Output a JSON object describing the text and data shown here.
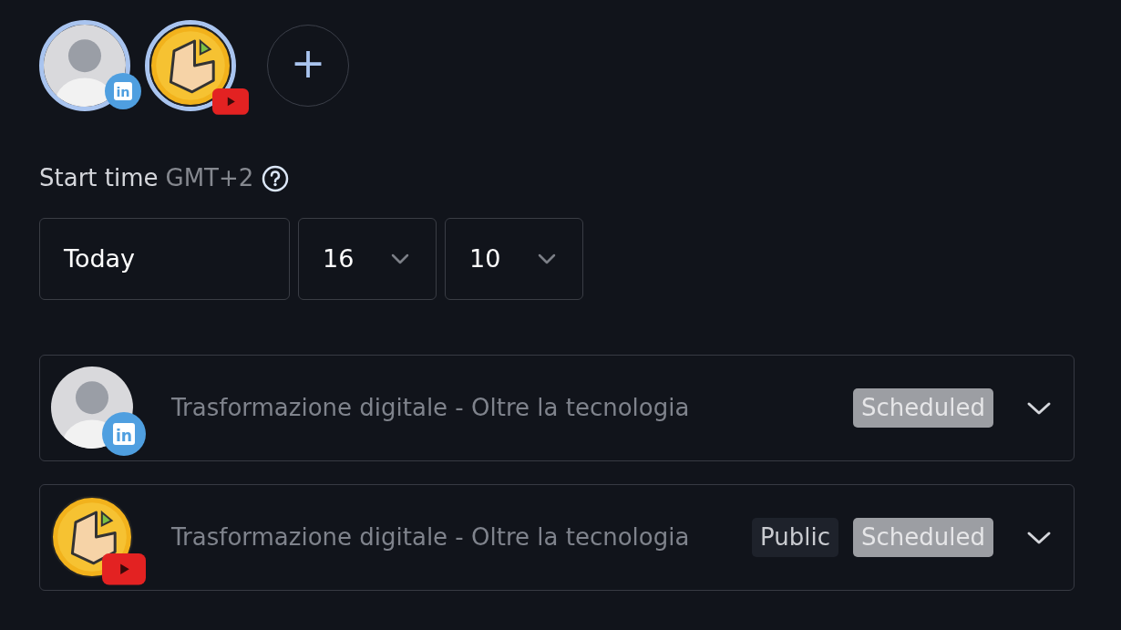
{
  "destinations": [
    {
      "kind": "linkedin",
      "icon_text": "in",
      "selected": true
    },
    {
      "kind": "youtube",
      "selected": true
    }
  ],
  "add_button": "+",
  "start_time": {
    "label": "Start time",
    "timezone": "GMT+2",
    "day": "Today",
    "hour": "16",
    "minute": "10"
  },
  "posts": [
    {
      "kind": "linkedin",
      "icon_text": "in",
      "title": "Trasformazione digitale - Oltre la tecnologia",
      "status": "Scheduled"
    },
    {
      "kind": "youtube",
      "title": "Trasformazione digitale - Oltre la tecnologia",
      "privacy": "Public",
      "status": "Scheduled"
    }
  ]
}
